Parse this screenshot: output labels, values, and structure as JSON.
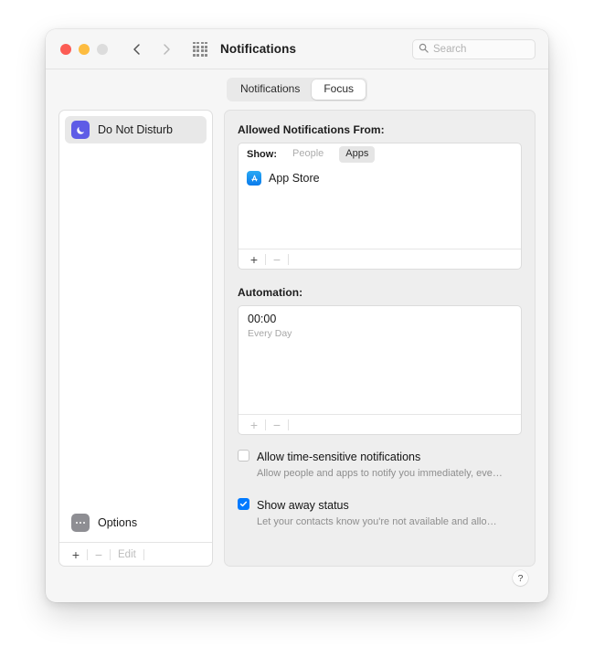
{
  "window": {
    "title": "Notifications",
    "traffic_lights": [
      "close",
      "minimize",
      "zoom"
    ],
    "nav": {
      "back": "back-chevron",
      "forward": "forward-chevron",
      "grid": "grid-icon"
    }
  },
  "search": {
    "placeholder": "Search",
    "value": "",
    "icon": "search-icon"
  },
  "tabs": [
    {
      "label": "Notifications",
      "active": false
    },
    {
      "label": "Focus",
      "active": true
    }
  ],
  "sidebar": {
    "items": [
      {
        "label": "Do Not Disturb",
        "icon": "moon-icon",
        "selected": true
      }
    ],
    "options": {
      "label": "Options",
      "icon": "ellipsis-icon"
    },
    "footer": {
      "add": "+",
      "remove": "−",
      "edit": "Edit"
    }
  },
  "panel": {
    "allowed": {
      "label": "Allowed Notifications From:",
      "show_label": "Show:",
      "segments": [
        {
          "label": "People",
          "active": false
        },
        {
          "label": "Apps",
          "active": true
        }
      ],
      "items": [
        {
          "label": "App Store",
          "icon": "app-store-icon"
        }
      ],
      "footer": {
        "add": "+",
        "remove": "−"
      }
    },
    "automation": {
      "label": "Automation:",
      "entries": [
        {
          "time": "00:00",
          "repeat": "Every Day"
        }
      ],
      "footer": {
        "add": "+",
        "remove": "−"
      }
    },
    "checkboxes": [
      {
        "title": "Allow time-sensitive notifications",
        "subtitle": "Allow people and apps to notify you immediately, eve…",
        "checked": false
      },
      {
        "title": "Show away status",
        "subtitle": "Let your contacts know you're not available and allo…",
        "checked": true
      }
    ]
  },
  "help": {
    "label": "?"
  },
  "colors": {
    "accent": "#007aff",
    "dnd_purple": "#5e5ce6",
    "app_store_blue": "#0a7bec",
    "window_bg": "#f6f6f6",
    "panel_bg": "#eeeeee"
  }
}
